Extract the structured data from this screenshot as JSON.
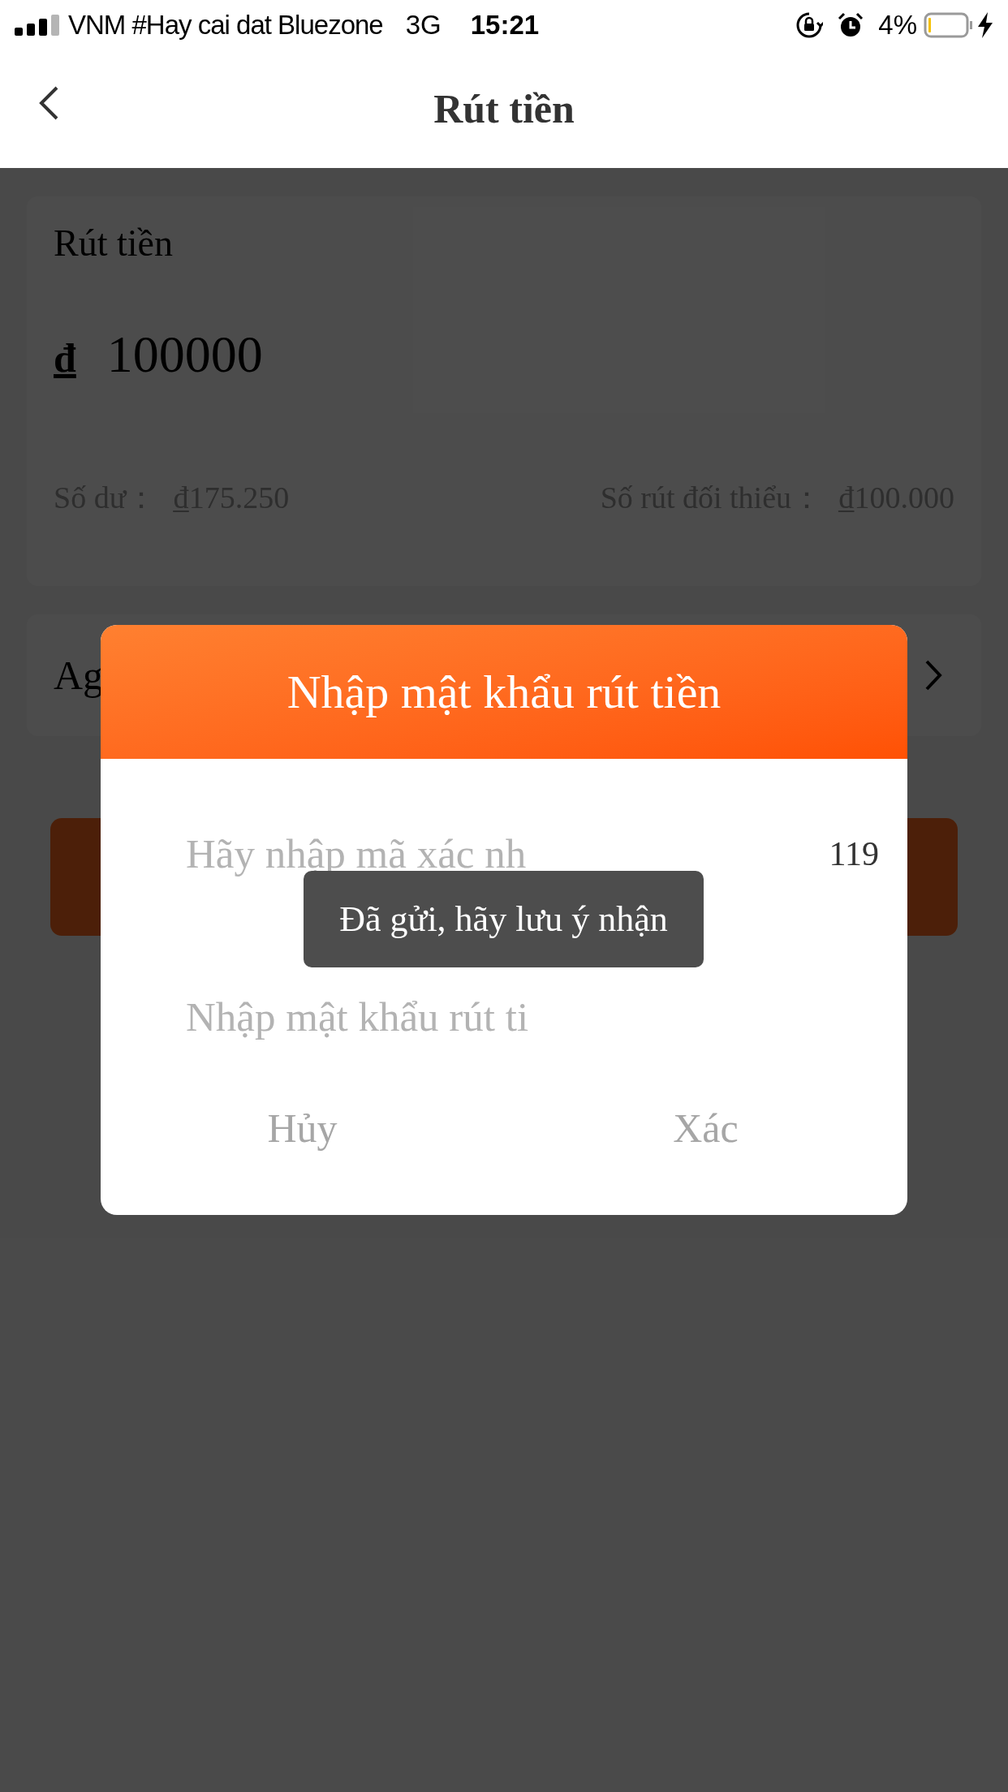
{
  "status_bar": {
    "carrier": "VNM #Hay cai dat Bluezone",
    "network": "3G",
    "time": "15:21",
    "battery": "4%",
    "charging": true
  },
  "nav": {
    "title": "Rút tiền"
  },
  "amount_card": {
    "title": "Rút tiền",
    "currency": "đ",
    "amount": "100000",
    "balance_label": "Số dư：",
    "balance": "₫175.250",
    "min_label": "Số rút đối thiểu：",
    "min": "₫100.000"
  },
  "bank_row": {
    "label": "Ag"
  },
  "dialog": {
    "title": "Nhập mật khẩu rút tiền",
    "code_field": {
      "placeholder": "Hãy nhập mã xác nh",
      "countdown": "119"
    },
    "password_field": {
      "placeholder": "Nhập mật khẩu rút ti"
    },
    "buttons": [
      "Hủy",
      "Xác"
    ]
  },
  "toast": {
    "text": "Đã gửi, hãy lưu ý nhận"
  }
}
